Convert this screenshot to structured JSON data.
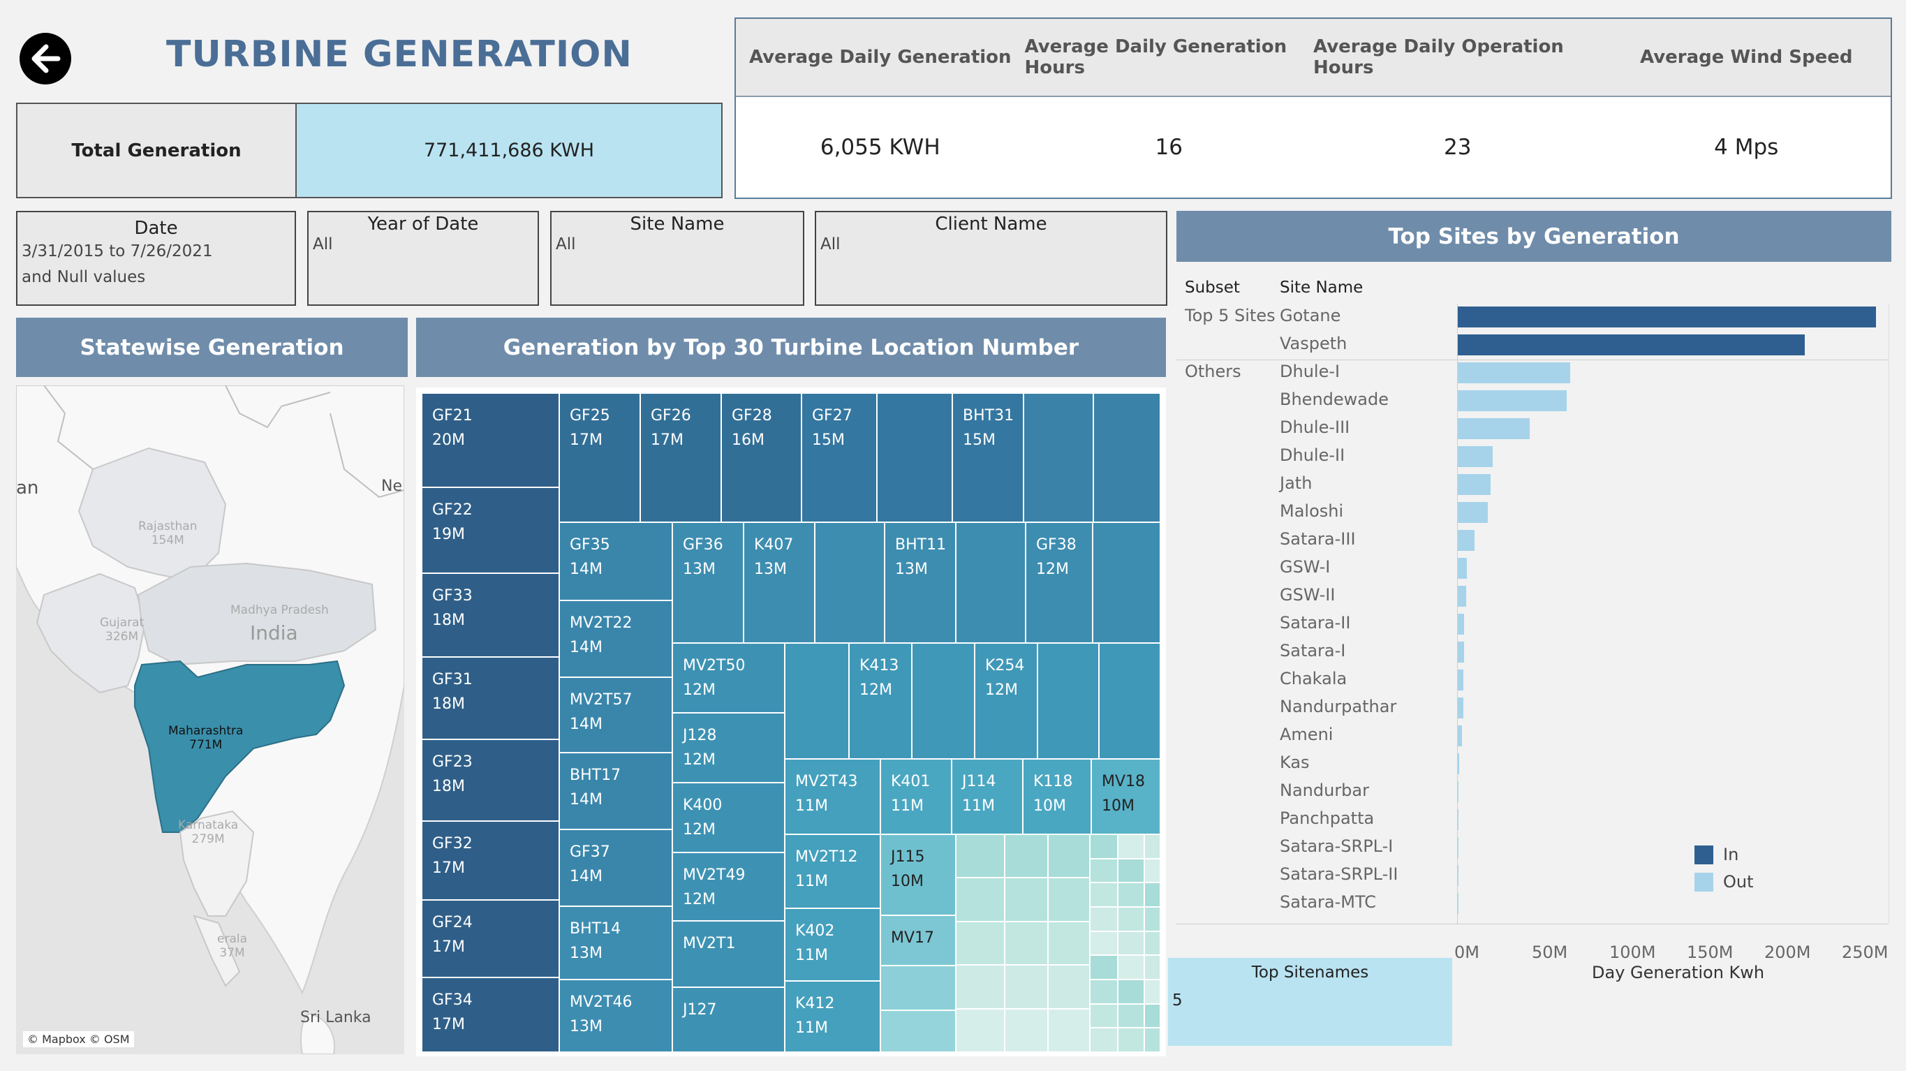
{
  "header": {
    "title": "TURBINE GENERATION"
  },
  "total": {
    "label": "Total Generation",
    "value": "771,411,686 KWH"
  },
  "kpis": [
    {
      "label": "Average Daily Generation",
      "value": "6,055 KWH"
    },
    {
      "label": "Average Daily Generation Hours",
      "value": "16"
    },
    {
      "label": "Average Daily Operation Hours",
      "value": "23"
    },
    {
      "label": "Average Wind Speed",
      "value": "4 Mps"
    }
  ],
  "filters": {
    "date": {
      "title": "Date",
      "lines": [
        "3/31/2015 to 7/26/2021",
        "and Null values"
      ]
    },
    "year": {
      "title": "Year of Date",
      "value": "All"
    },
    "site": {
      "title": "Site Name",
      "value": "All"
    },
    "client": {
      "title": "Client Name",
      "value": "All"
    }
  },
  "map": {
    "title": "Statewise Generation",
    "labels": {
      "an": "an",
      "ne": "Ne",
      "rajasthan": "Rajasthan",
      "rajasthan_v": "154M",
      "gujarat": "Gujarat",
      "gujarat_v": "326M",
      "mp": "Madhya Pradesh",
      "mp_v": "...",
      "india": "India",
      "mh": "Maharashtra",
      "mh_v": "771M",
      "karnataka": "Karnataka",
      "karnataka_v": "279M",
      "kerala": "erala",
      "kerala_v": "37M",
      "srilanka": "Sri Lanka",
      "credit": "© Mapbox © OSM"
    },
    "colors": {
      "highlight": "#3a8fab",
      "land": "#fafafa",
      "states": "#dcdfe3",
      "water": "#e4e4e4"
    }
  },
  "treemap": {
    "title": "Generation by Top 30 Turbine Location Number",
    "tiles": [
      {
        "label": "GF21",
        "value": "20M"
      },
      {
        "label": "GF22",
        "value": "19M"
      },
      {
        "label": "GF33",
        "value": "18M"
      },
      {
        "label": "GF31",
        "value": "18M"
      },
      {
        "label": "GF23",
        "value": "18M"
      },
      {
        "label": "GF32",
        "value": "17M"
      },
      {
        "label": "GF24",
        "value": "17M"
      },
      {
        "label": "GF34",
        "value": "17M"
      },
      {
        "label": "GF25",
        "value": "17M"
      },
      {
        "label": "GF26",
        "value": "17M"
      },
      {
        "label": "GF28",
        "value": "16M"
      },
      {
        "label": "GF27",
        "value": "15M"
      },
      {
        "label": "BHT31",
        "value": "15M"
      },
      {
        "label": "GF35",
        "value": "14M"
      },
      {
        "label": "MV2T22",
        "value": "14M"
      },
      {
        "label": "MV2T57",
        "value": "14M"
      },
      {
        "label": "BHT17",
        "value": "14M"
      },
      {
        "label": "GF37",
        "value": "14M"
      },
      {
        "label": "BHT14",
        "value": "13M"
      },
      {
        "label": "MV2T46",
        "value": "13M"
      },
      {
        "label": "GF36",
        "value": "13M"
      },
      {
        "label": "K407",
        "value": "13M"
      },
      {
        "label": "BHT11",
        "value": "13M"
      },
      {
        "label": "GF38",
        "value": "12M"
      },
      {
        "label": "MV2T50",
        "value": "12M"
      },
      {
        "label": "J128",
        "value": "12M"
      },
      {
        "label": "K400",
        "value": "12M"
      },
      {
        "label": "MV2T49",
        "value": "12M"
      },
      {
        "label": "MV2T1",
        "value": ""
      },
      {
        "label": "J127",
        "value": ""
      },
      {
        "label": "K413",
        "value": "12M"
      },
      {
        "label": "K254",
        "value": "12M"
      },
      {
        "label": "MV2T43",
        "value": "11M"
      },
      {
        "label": "MV2T12",
        "value": "11M"
      },
      {
        "label": "K402",
        "value": "11M"
      },
      {
        "label": "K412",
        "value": "11M"
      },
      {
        "label": "K401",
        "value": "11M"
      },
      {
        "label": "J114",
        "value": "11M"
      },
      {
        "label": "K118",
        "value": "10M"
      },
      {
        "label": "MV18",
        "value": "10M"
      },
      {
        "label": "J115",
        "value": "10M"
      },
      {
        "label": "MV17",
        "value": ""
      }
    ]
  },
  "bar": {
    "title": "Top Sites by Generation",
    "col_subset": "Subset",
    "col_site": "Site Name",
    "x_title": "Day Generation Kwh",
    "legend": [
      {
        "label": "In",
        "color": "#2f5f91"
      },
      {
        "label": "Out",
        "color": "#a6d3ea"
      }
    ]
  },
  "chart_data": {
    "type": "bar",
    "orientation": "horizontal",
    "title": "Top Sites by Generation",
    "xlabel": "Day Generation Kwh",
    "xlim": [
      0,
      260000000
    ],
    "ticks": [
      "0M",
      "50M",
      "100M",
      "150M",
      "200M",
      "250M"
    ],
    "groups": [
      {
        "subset": "Top 5 Sites",
        "sites": [
          {
            "name": "Gotane",
            "value": 260000000,
            "set": "In"
          },
          {
            "name": "Vaspeth",
            "value": 216000000,
            "set": "In"
          }
        ]
      },
      {
        "subset": "Others",
        "sites": [
          {
            "name": "Dhule-I",
            "value": 70000000,
            "set": "Out"
          },
          {
            "name": "Bhendewade",
            "value": 68000000,
            "set": "Out"
          },
          {
            "name": "Dhule-III",
            "value": 45000000,
            "set": "Out"
          },
          {
            "name": "Dhule-II",
            "value": 22000000,
            "set": "Out"
          },
          {
            "name": "Jath",
            "value": 21000000,
            "set": "Out"
          },
          {
            "name": "Maloshi",
            "value": 19000000,
            "set": "Out"
          },
          {
            "name": "Satara-III",
            "value": 11000000,
            "set": "Out"
          },
          {
            "name": "GSW-I",
            "value": 6000000,
            "set": "Out"
          },
          {
            "name": "GSW-II",
            "value": 5500000,
            "set": "Out"
          },
          {
            "name": "Satara-II",
            "value": 4500000,
            "set": "Out"
          },
          {
            "name": "Satara-I",
            "value": 4200000,
            "set": "Out"
          },
          {
            "name": "Chakala",
            "value": 4000000,
            "set": "Out"
          },
          {
            "name": "Nandurpathar",
            "value": 3700000,
            "set": "Out"
          },
          {
            "name": "Ameni",
            "value": 3200000,
            "set": "Out"
          },
          {
            "name": "Kas",
            "value": 1200000,
            "set": "Out"
          },
          {
            "name": "Nandurbar",
            "value": 1000000,
            "set": "Out"
          },
          {
            "name": "Panchpatta",
            "value": 800000,
            "set": "Out"
          },
          {
            "name": "Satara-SRPL-I",
            "value": 600000,
            "set": "Out"
          },
          {
            "name": "Satara-SRPL-II",
            "value": 500000,
            "set": "Out"
          },
          {
            "name": "Satara-MTC",
            "value": 400000,
            "set": "Out"
          }
        ]
      }
    ]
  },
  "top_sitenames": {
    "title": "Top Sitenames",
    "value": "5"
  }
}
